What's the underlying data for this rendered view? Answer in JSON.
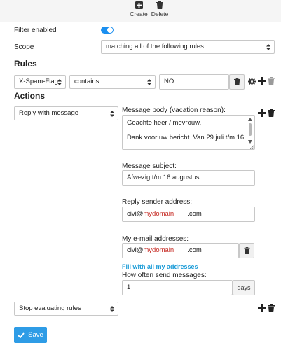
{
  "toolbar": {
    "create_label": "Create",
    "delete_label": "Delete"
  },
  "filter": {
    "enabled_label": "Filter enabled",
    "enabled": true,
    "scope_label": "Scope",
    "scope_value": "matching all of the following rules"
  },
  "rules": {
    "heading": "Rules",
    "header_value": "X-Spam-Flag",
    "operator_value": "contains",
    "target_value": "NO"
  },
  "actions": {
    "heading": "Actions",
    "action1_value": "Reply with message",
    "body_label": "Message body (vacation reason):",
    "body_lines": [
      "Geachte heer / mevrouw,",
      "Dank voor uw bericht. Van 29 juli t/m 16"
    ],
    "subject_label": "Message subject:",
    "subject_value": "Afwezig t/m 16 augustus",
    "sender_label": "Reply sender address:",
    "sender_prefix": "civi@",
    "sender_domain": "mydomain",
    "sender_suffix": ".com",
    "myaddr_label": "My e-mail addresses:",
    "myaddr_prefix": "civi@",
    "myaddr_domain": "mydomain",
    "myaddr_suffix": ".com",
    "fill_link": "Fill with all my addresses",
    "often_label": "How often send messages:",
    "often_value": "1",
    "often_unit": "days",
    "action2_value": "Stop evaluating rules"
  },
  "footer": {
    "save_label": "Save"
  },
  "colors": {
    "accent": "#2e9ce6",
    "toggle": "#1b8ff0",
    "link": "#1a9bd7",
    "highlight": "#c62b24"
  }
}
